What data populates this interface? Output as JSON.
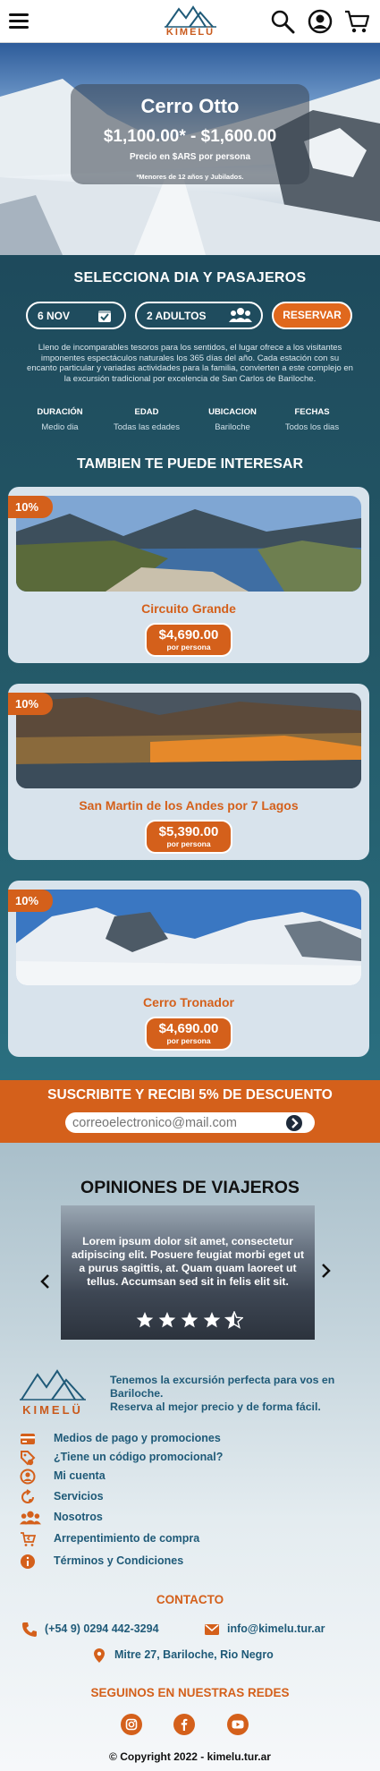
{
  "brand": {
    "name": "KIMELÜ",
    "accent": "#d4601b",
    "navy": "#1f5a78"
  },
  "header": {
    "icons": [
      "hamburger-icon",
      "search-icon",
      "user-icon",
      "cart-icon"
    ]
  },
  "hero": {
    "title": "Cerro Otto",
    "price": "$1,100.00* - $1,600.00",
    "price_caption": "Precio en $ARS por persona",
    "note": "*Menores de 12 años y Jubilados."
  },
  "booking": {
    "title": "SELECCIONA DIA Y PASAJEROS",
    "date_value": "6 NOV",
    "passengers_value": "2 ADULTOS",
    "reserve_label": "RESERVAR"
  },
  "description": "Lleno de incomparables tesoros para los sentidos, el lugar ofrece a los visitantes imponentes espectáculos naturales los 365 días del año. Cada estación con su encanto particular y variadas actividades para la familia, convierten a este complejo en la excursión tradicional por excelencia de San Carlos de Bariloche.",
  "specs": [
    {
      "label": "DURACIÓN",
      "value": "Medio dia"
    },
    {
      "label": "EDAD",
      "value": "Todas las edades"
    },
    {
      "label": "UBICACION",
      "value": "Bariloche"
    },
    {
      "label": "FECHAS",
      "value": "Todos los dias"
    }
  ],
  "interest": {
    "title": "TAMBIEN TE PUEDE INTERESAR",
    "tours": [
      {
        "badge": "10%",
        "name": "Circuito Grande",
        "price": "$4,690.00",
        "per": "por persona"
      },
      {
        "badge": "10%",
        "name": "San Martin de los Andes por 7 Lagos",
        "price": "$5,390.00",
        "per": "por persona"
      },
      {
        "badge": "10%",
        "name": "Cerro Tronador",
        "price": "$4,690.00",
        "per": "por persona"
      }
    ]
  },
  "subscribe": {
    "title": "SUSCRIBITE Y RECIBI 5% DE DESCUENTO",
    "placeholder": "correoelectronico@mail.com"
  },
  "reviews": {
    "title": "OPINIONES DE VIAJEROS",
    "text": "Lorem ipsum dolor sit amet, consectetur adipiscing elit. Posuere feugiat morbi eget ut a purus sagittis, at. Quam quam laoreet ut tellus. Accumsan sed sit in felis elit sit.",
    "rating": 4.5
  },
  "footer": {
    "tagline_1": "Tenemos la excursión perfecta para vos en Bariloche.",
    "tagline_2": "Reserva al mejor precio y de forma fácil.",
    "links": [
      {
        "label": "Medios de pago y promociones",
        "icon": "card-icon"
      },
      {
        "label": "¿Tiene un código promocional?",
        "icon": "tag-icon"
      },
      {
        "label": "Mi cuenta",
        "icon": "account-icon"
      },
      {
        "label": "Servicios",
        "icon": "services-icon"
      },
      {
        "label": "Nosotros",
        "icon": "group-icon"
      },
      {
        "label": "Arrepentimiento de compra",
        "icon": "cart-return-icon"
      },
      {
        "label": "Términos y Condiciones",
        "icon": "info-icon"
      }
    ],
    "contact_title": "CONTACTO",
    "phone": "(+54 9) 0294 442-3294",
    "email": "info@kimelu.tur.ar",
    "address": "Mitre 27, Bariloche, Rio Negro",
    "social_title": "SEGUINOS EN NUESTRAS REDES",
    "social": [
      "instagram-icon",
      "facebook-icon",
      "youtube-icon"
    ],
    "copyright": "© Copyright 2022 - kimelu.tur.ar"
  }
}
